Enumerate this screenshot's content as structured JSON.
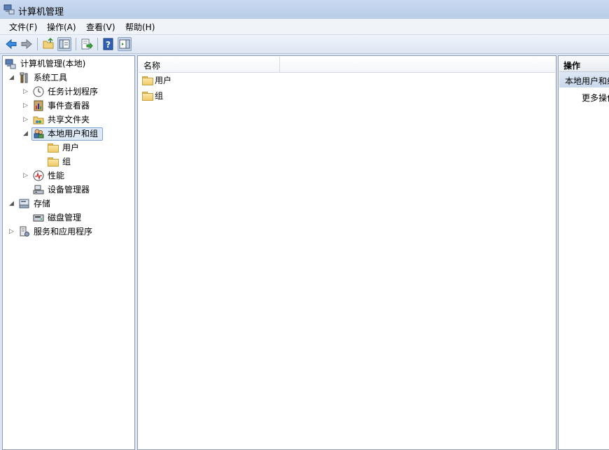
{
  "window": {
    "title": "计算机管理"
  },
  "menu": [
    {
      "label": "文件(F)"
    },
    {
      "label": "操作(A)"
    },
    {
      "label": "查看(V)"
    },
    {
      "label": "帮助(H)"
    }
  ],
  "toolbar": {
    "back": "back-arrow-icon",
    "forward": "forward-arrow-icon",
    "up": "up-folder-icon",
    "show_hide_tree": "console-tree-icon",
    "export": "export-list-icon",
    "help": "help-icon",
    "show_hide_action": "action-pane-icon"
  },
  "tree": {
    "root": "计算机管理(本地)",
    "system_tools": "系统工具",
    "task_scheduler": "任务计划程序",
    "event_viewer": "事件查看器",
    "shared_folders": "共享文件夹",
    "local_users_groups": "本地用户和组",
    "users": "用户",
    "groups": "组",
    "performance": "性能",
    "device_manager": "设备管理器",
    "storage": "存储",
    "disk_management": "磁盘管理",
    "services_apps": "服务和应用程序"
  },
  "list": {
    "column_name": "名称",
    "items": [
      "用户",
      "组"
    ]
  },
  "actions": {
    "header": "操作",
    "section": "本地用户和组",
    "more": "更多操作"
  }
}
